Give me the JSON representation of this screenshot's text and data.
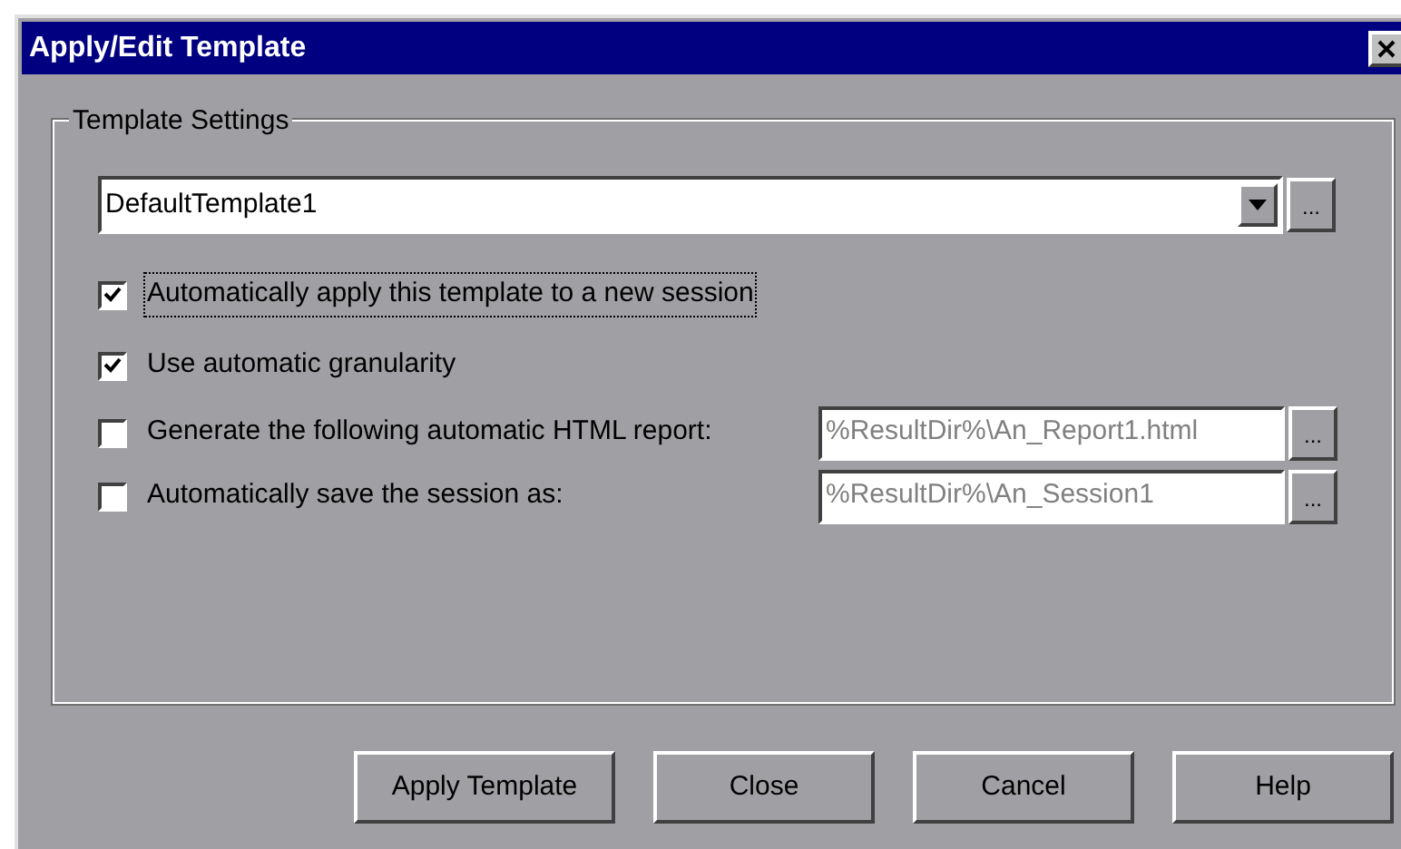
{
  "window": {
    "title": "Apply/Edit Template"
  },
  "group": {
    "label": "Template Settings"
  },
  "template_select": {
    "value": "DefaultTemplate1",
    "browse": "..."
  },
  "options": [
    {
      "kind": "checkbox",
      "label": "Automatically apply this template to a new session",
      "checked": true,
      "focused": true
    },
    {
      "kind": "checkbox",
      "label": "Use automatic granularity",
      "checked": true,
      "focused": false
    },
    {
      "kind": "path",
      "label": "Generate the following automatic HTML report:",
      "checked": false,
      "focused": false,
      "field": {
        "value": "%ResultDir%\\An_Report1.html",
        "disabled": true
      },
      "browse": "..."
    },
    {
      "kind": "path",
      "label": "Automatically save the session as:",
      "checked": false,
      "focused": false,
      "field": {
        "value": "%ResultDir%\\An_Session1",
        "disabled": true
      },
      "browse": "..."
    }
  ],
  "buttons": [
    "Apply Template",
    "Close",
    "Cancel",
    "Help"
  ]
}
